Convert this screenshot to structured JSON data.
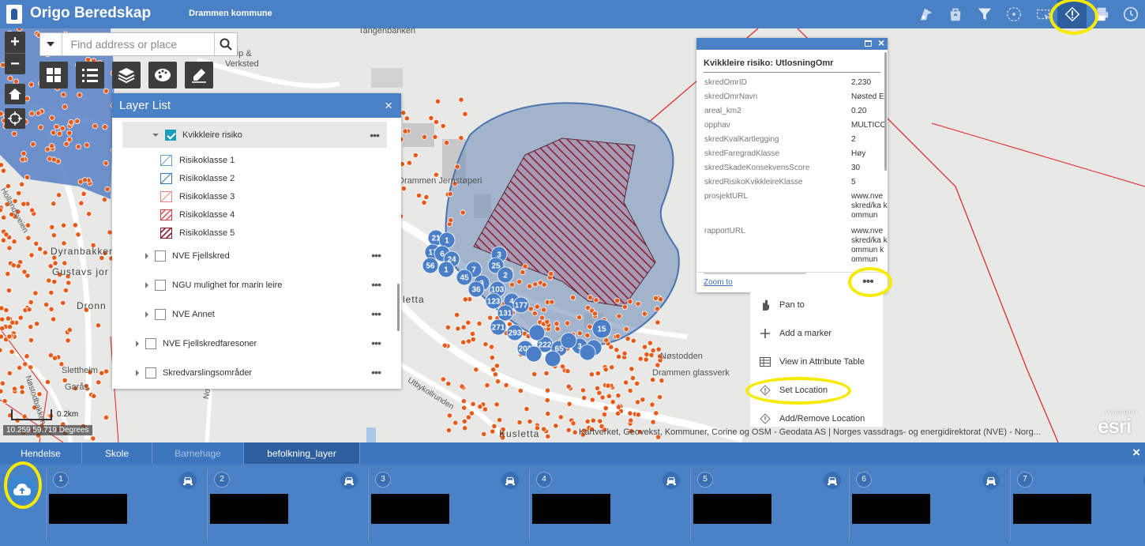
{
  "header": {
    "title": "Origo Beredskap",
    "subtitle": "Drammen kommune",
    "tools": [
      {
        "icon": "map-pin-tool-icon"
      },
      {
        "icon": "bag-tool-icon"
      },
      {
        "icon": "filter-icon"
      },
      {
        "icon": "compass-icon"
      },
      {
        "icon": "select-tool-icon"
      },
      {
        "icon": "set-location-icon",
        "active": true
      },
      {
        "icon": "print-icon"
      },
      {
        "icon": "clock-icon"
      }
    ]
  },
  "search": {
    "placeholder": "Find address or place"
  },
  "map": {
    "labels": {
      "tangenbanken": "Tangenbanken",
      "slip": "Nedre Slip &",
      "verksted": "Verksted",
      "jernstoperi": "Drammen Jernstøperi",
      "dyranbakken": "Dyranbakken",
      "gustavs": "Gustavs jor",
      "dronn": "Dronn",
      "letta": "letta",
      "nostodden": "Nøstodden",
      "glassverk": "Drammen glassverk",
      "slettheim": "Slettheim",
      "garas": "Garås",
      "kusletta": "Kusletta",
      "hollandsveien": "Hollandsveien",
      "utbykollrunden": "Utbykollrunden",
      "nordbyveien": "Nordbyveien",
      "nostodbakken": "Nøstodbakken"
    },
    "scale_label": "0.2km",
    "coordinates": "10.259 59.719 Degrees",
    "attribution": "Kartverket, Geovekst, Kommuner, Corine og OSM - Geodata AS | Norges vassdrags- og energidirektorat (NVE) - Norg...",
    "esri_logo": "esri",
    "esri_powered": "POWERED BY",
    "cluster_labels": [
      "21",
      "1",
      "17",
      "6",
      "24",
      "56",
      "1",
      "7",
      "3",
      "25",
      "2",
      "45",
      "3",
      "103",
      "36",
      "4",
      "123",
      "131",
      "177",
      "271",
      "293",
      "203",
      "222",
      "65",
      "15",
      "3"
    ]
  },
  "layer_list": {
    "title": "Layer List",
    "items": [
      {
        "label": "Kvikkleire risiko",
        "checked": true,
        "expanded": true
      },
      {
        "label": "Risikoklasse 1",
        "color": "#6aa0c8",
        "pattern": "light"
      },
      {
        "label": "Risikoklasse 2",
        "color": "#3a78b8",
        "pattern": "light"
      },
      {
        "label": "Risikoklasse 3",
        "color": "#f08080",
        "pattern": "light"
      },
      {
        "label": "Risikoklasse 4",
        "color": "#d94040",
        "pattern": "dense"
      },
      {
        "label": "Risikoklasse 5",
        "color": "#8b1a2a",
        "pattern": "dense"
      },
      {
        "label": "NVE Fjellskred",
        "checked": false
      },
      {
        "label": "NGU mulighet for marin leire",
        "checked": false
      },
      {
        "label": "NVE Annet",
        "checked": false
      },
      {
        "label": "NVE Fjellskredfaresoner",
        "checked": false
      },
      {
        "label": "Skredvarslingsområder",
        "checked": false
      }
    ]
  },
  "popup": {
    "title": "Kvikkleire risiko: UtlosningOmr",
    "fields": [
      {
        "key": "skredOmrID",
        "value": "2,230"
      },
      {
        "key": "skredOmrNavn",
        "value": "Nøsted E"
      },
      {
        "key": "areal_km2",
        "value": "0.20"
      },
      {
        "key": "opphav",
        "value": "MULTICO"
      },
      {
        "key": "skredKvalKartlegging",
        "value": "2"
      },
      {
        "key": "skredFaregradKlasse",
        "value": "Høy"
      },
      {
        "key": "skredSkadeKonsekvensScore",
        "value": "30"
      },
      {
        "key": "skredRisikoKvikkleireKlasse",
        "value": "5"
      },
      {
        "key": "prosjektURL",
        "value": "www.nve skred/ka kommun"
      },
      {
        "key": "rapportURL",
        "value": "www.nve skred/ka kommun kommun"
      }
    ],
    "zoom_to": "Zoom to",
    "more": "•••"
  },
  "context_menu": {
    "items": [
      {
        "label": "Pan to",
        "icon": "pan-icon"
      },
      {
        "label": "Add a marker",
        "icon": "plus-icon"
      },
      {
        "label": "View in Attribute Table",
        "icon": "table-icon"
      },
      {
        "label": "Set Location",
        "icon": "set-location-icon"
      },
      {
        "label": "Add/Remove Location",
        "icon": "location-icon"
      }
    ]
  },
  "bottom": {
    "tabs": [
      {
        "label": "Hendelse"
      },
      {
        "label": "Skole"
      },
      {
        "label": "Barnehage"
      },
      {
        "label": "befolkning_layer"
      }
    ],
    "close": "×",
    "cards": [
      "1",
      "2",
      "3",
      "4",
      "5",
      "6",
      "7"
    ]
  },
  "colors": {
    "header": "#4a80c4",
    "panel": "#3d76bd",
    "highlight": "#f5ea00",
    "poly_fill": "#7b98bd",
    "hatch": "#8b1a2a",
    "cluster": "#4a7ec6",
    "dot": "#e85a1a"
  }
}
